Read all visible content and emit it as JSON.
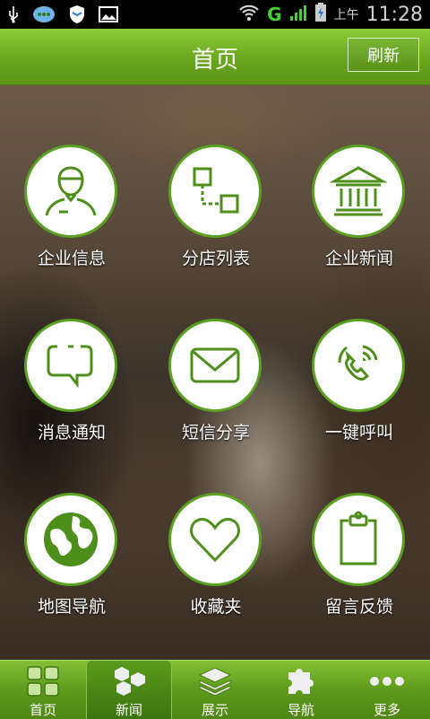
{
  "status_bar": {
    "am_pm": "上午",
    "time": "11:28",
    "network": "G"
  },
  "header": {
    "title": "首页",
    "refresh_label": "刷新"
  },
  "grid": [
    {
      "id": "company-info",
      "label": "企业信息",
      "icon": "person-icon"
    },
    {
      "id": "branch-list",
      "label": "分店列表",
      "icon": "branch-icon"
    },
    {
      "id": "company-news",
      "label": "企业新闻",
      "icon": "building-icon"
    },
    {
      "id": "message-notice",
      "label": "消息通知",
      "icon": "chat-bubble-icon"
    },
    {
      "id": "sms-share",
      "label": "短信分享",
      "icon": "envelope-icon"
    },
    {
      "id": "one-key-call",
      "label": "一键呼叫",
      "icon": "phone-icon"
    },
    {
      "id": "map-nav",
      "label": "地图导航",
      "icon": "globe-icon"
    },
    {
      "id": "favorites",
      "label": "收藏夹",
      "icon": "heart-icon"
    },
    {
      "id": "feedback",
      "label": "留言反馈",
      "icon": "clipboard-icon"
    }
  ],
  "tabs": [
    {
      "label": "首页",
      "icon": "grid-icon"
    },
    {
      "label": "新闻",
      "icon": "hexagons-icon"
    },
    {
      "label": "展示",
      "icon": "stack-icon"
    },
    {
      "label": "导航",
      "icon": "puzzle-icon"
    },
    {
      "label": "更多",
      "icon": "more-dots-icon"
    }
  ],
  "colors": {
    "brand_green": "#6aa61e",
    "icon_green": "#4e8f1b",
    "status_network": "#42d130"
  }
}
